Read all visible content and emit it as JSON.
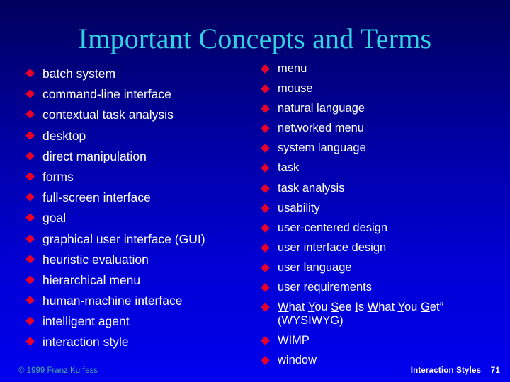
{
  "slide": {
    "title": "Important Concepts and Terms",
    "colors": {
      "background_top": "#00005c",
      "background_bottom": "#0000ee",
      "title_text": "#32d2e2",
      "body_text": "#ffffff",
      "bullet_marker": "#e8002a",
      "copyright_text": "#4aa89a"
    }
  },
  "columns": {
    "left": {
      "items": [
        {
          "label": "batch system"
        },
        {
          "label": "command-line interface"
        },
        {
          "label": "contextual task analysis"
        },
        {
          "label": "desktop"
        },
        {
          "label": "direct manipulation"
        },
        {
          "label": "forms"
        },
        {
          "label": "full-screen interface"
        },
        {
          "label": "goal"
        },
        {
          "label": "graphical user interface (GUI)"
        },
        {
          "label": "heuristic evaluation"
        },
        {
          "label": "hierarchical menu"
        },
        {
          "label": "human-machine interface"
        },
        {
          "label": "intelligent agent"
        },
        {
          "label": "interaction style"
        }
      ]
    },
    "right": {
      "items": [
        {
          "label": "menu"
        },
        {
          "label": "mouse"
        },
        {
          "label": "natural language"
        },
        {
          "label": "networked menu"
        },
        {
          "label": "system language"
        },
        {
          "label": "task"
        },
        {
          "label": "task analysis"
        },
        {
          "label": "usability"
        },
        {
          "label": "user-centered design"
        },
        {
          "label": "user interface design"
        },
        {
          "label": "user language"
        },
        {
          "label": "user requirements"
        },
        {
          "label": "What You See Is What You Get” (WYSIWYG)"
        },
        {
          "label": "WIMP"
        },
        {
          "label": "window"
        }
      ]
    }
  },
  "footer": {
    "copyright": "© 1999 Franz Kurfess",
    "page_label": "Interaction Styles",
    "page_number": "71"
  }
}
